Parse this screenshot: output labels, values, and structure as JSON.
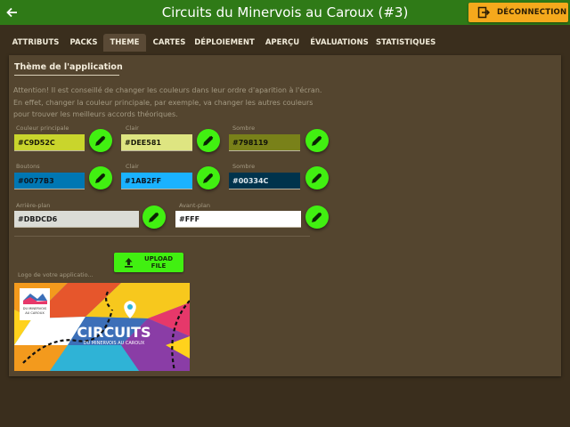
{
  "header": {
    "title": "Circuits du Minervois au Caroux (#3)",
    "logout_label": "Déconnection"
  },
  "tabs": [
    "Attributs",
    "Packs",
    "Theme",
    "Cartes",
    "Déploiement",
    "Aperçu",
    "Évaluations",
    "Statistiques"
  ],
  "active_tab": "Theme",
  "theme": {
    "section_title": "Thème de l'application",
    "warning": "Attention! Il est conseillé de changer les couleurs dans leur ordre d'aparition à l'écran. En effet, changer la couleur principale, par exemple, va changer les autres couleurs pour trouver les meilleurs accords théoriques.",
    "primary": {
      "label": "Couleur principale",
      "value": "#C9D52C",
      "light_label": "Clair",
      "light_value": "#DEE581",
      "dark_label": "Sombre",
      "dark_value": "#798119"
    },
    "buttons": {
      "label": "Boutons",
      "value": "#0077B3",
      "light_label": "Clair",
      "light_value": "#1AB2FF",
      "dark_label": "Sombre",
      "dark_value": "#00334C"
    },
    "background": {
      "label": "Arrière-plan",
      "value": "#DBDCD6",
      "fg_label": "Avant-plan",
      "fg_value": "#FFF"
    },
    "upload_label": "Upload file",
    "logo_label": "Logo de votre applicatio...",
    "logo": {
      "brand_lines": [
        "DU MINERVOIS",
        "AU CAROUX"
      ],
      "headline": "CIRCUITS",
      "subline": "DU MINERVOIS AU CAROUX"
    }
  },
  "colors": {
    "topbar": "#2F7A17",
    "logout": "#F5A91C",
    "accent_green": "#41F011"
  }
}
